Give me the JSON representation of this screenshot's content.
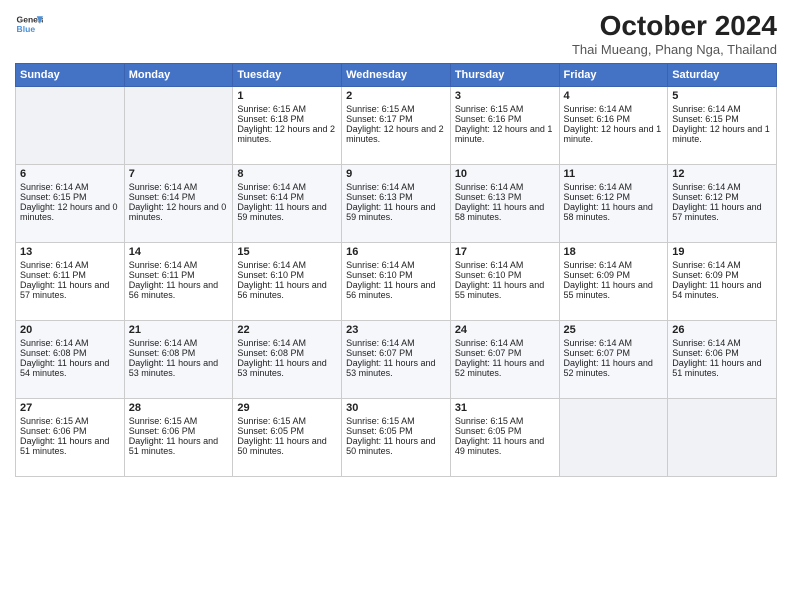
{
  "logo": {
    "line1": "General",
    "line2": "Blue"
  },
  "title": "October 2024",
  "subtitle": "Thai Mueang, Phang Nga, Thailand",
  "days_header": [
    "Sunday",
    "Monday",
    "Tuesday",
    "Wednesday",
    "Thursday",
    "Friday",
    "Saturday"
  ],
  "weeks": [
    [
      {
        "day": "",
        "empty": true
      },
      {
        "day": "",
        "empty": true
      },
      {
        "day": "1",
        "sunrise": "Sunrise: 6:15 AM",
        "sunset": "Sunset: 6:18 PM",
        "daylight": "Daylight: 12 hours and 2 minutes."
      },
      {
        "day": "2",
        "sunrise": "Sunrise: 6:15 AM",
        "sunset": "Sunset: 6:17 PM",
        "daylight": "Daylight: 12 hours and 2 minutes."
      },
      {
        "day": "3",
        "sunrise": "Sunrise: 6:15 AM",
        "sunset": "Sunset: 6:16 PM",
        "daylight": "Daylight: 12 hours and 1 minute."
      },
      {
        "day": "4",
        "sunrise": "Sunrise: 6:14 AM",
        "sunset": "Sunset: 6:16 PM",
        "daylight": "Daylight: 12 hours and 1 minute."
      },
      {
        "day": "5",
        "sunrise": "Sunrise: 6:14 AM",
        "sunset": "Sunset: 6:15 PM",
        "daylight": "Daylight: 12 hours and 1 minute."
      }
    ],
    [
      {
        "day": "6",
        "sunrise": "Sunrise: 6:14 AM",
        "sunset": "Sunset: 6:15 PM",
        "daylight": "Daylight: 12 hours and 0 minutes."
      },
      {
        "day": "7",
        "sunrise": "Sunrise: 6:14 AM",
        "sunset": "Sunset: 6:14 PM",
        "daylight": "Daylight: 12 hours and 0 minutes."
      },
      {
        "day": "8",
        "sunrise": "Sunrise: 6:14 AM",
        "sunset": "Sunset: 6:14 PM",
        "daylight": "Daylight: 11 hours and 59 minutes."
      },
      {
        "day": "9",
        "sunrise": "Sunrise: 6:14 AM",
        "sunset": "Sunset: 6:13 PM",
        "daylight": "Daylight: 11 hours and 59 minutes."
      },
      {
        "day": "10",
        "sunrise": "Sunrise: 6:14 AM",
        "sunset": "Sunset: 6:13 PM",
        "daylight": "Daylight: 11 hours and 58 minutes."
      },
      {
        "day": "11",
        "sunrise": "Sunrise: 6:14 AM",
        "sunset": "Sunset: 6:12 PM",
        "daylight": "Daylight: 11 hours and 58 minutes."
      },
      {
        "day": "12",
        "sunrise": "Sunrise: 6:14 AM",
        "sunset": "Sunset: 6:12 PM",
        "daylight": "Daylight: 11 hours and 57 minutes."
      }
    ],
    [
      {
        "day": "13",
        "sunrise": "Sunrise: 6:14 AM",
        "sunset": "Sunset: 6:11 PM",
        "daylight": "Daylight: 11 hours and 57 minutes."
      },
      {
        "day": "14",
        "sunrise": "Sunrise: 6:14 AM",
        "sunset": "Sunset: 6:11 PM",
        "daylight": "Daylight: 11 hours and 56 minutes."
      },
      {
        "day": "15",
        "sunrise": "Sunrise: 6:14 AM",
        "sunset": "Sunset: 6:10 PM",
        "daylight": "Daylight: 11 hours and 56 minutes."
      },
      {
        "day": "16",
        "sunrise": "Sunrise: 6:14 AM",
        "sunset": "Sunset: 6:10 PM",
        "daylight": "Daylight: 11 hours and 56 minutes."
      },
      {
        "day": "17",
        "sunrise": "Sunrise: 6:14 AM",
        "sunset": "Sunset: 6:10 PM",
        "daylight": "Daylight: 11 hours and 55 minutes."
      },
      {
        "day": "18",
        "sunrise": "Sunrise: 6:14 AM",
        "sunset": "Sunset: 6:09 PM",
        "daylight": "Daylight: 11 hours and 55 minutes."
      },
      {
        "day": "19",
        "sunrise": "Sunrise: 6:14 AM",
        "sunset": "Sunset: 6:09 PM",
        "daylight": "Daylight: 11 hours and 54 minutes."
      }
    ],
    [
      {
        "day": "20",
        "sunrise": "Sunrise: 6:14 AM",
        "sunset": "Sunset: 6:08 PM",
        "daylight": "Daylight: 11 hours and 54 minutes."
      },
      {
        "day": "21",
        "sunrise": "Sunrise: 6:14 AM",
        "sunset": "Sunset: 6:08 PM",
        "daylight": "Daylight: 11 hours and 53 minutes."
      },
      {
        "day": "22",
        "sunrise": "Sunrise: 6:14 AM",
        "sunset": "Sunset: 6:08 PM",
        "daylight": "Daylight: 11 hours and 53 minutes."
      },
      {
        "day": "23",
        "sunrise": "Sunrise: 6:14 AM",
        "sunset": "Sunset: 6:07 PM",
        "daylight": "Daylight: 11 hours and 53 minutes."
      },
      {
        "day": "24",
        "sunrise": "Sunrise: 6:14 AM",
        "sunset": "Sunset: 6:07 PM",
        "daylight": "Daylight: 11 hours and 52 minutes."
      },
      {
        "day": "25",
        "sunrise": "Sunrise: 6:14 AM",
        "sunset": "Sunset: 6:07 PM",
        "daylight": "Daylight: 11 hours and 52 minutes."
      },
      {
        "day": "26",
        "sunrise": "Sunrise: 6:14 AM",
        "sunset": "Sunset: 6:06 PM",
        "daylight": "Daylight: 11 hours and 51 minutes."
      }
    ],
    [
      {
        "day": "27",
        "sunrise": "Sunrise: 6:15 AM",
        "sunset": "Sunset: 6:06 PM",
        "daylight": "Daylight: 11 hours and 51 minutes."
      },
      {
        "day": "28",
        "sunrise": "Sunrise: 6:15 AM",
        "sunset": "Sunset: 6:06 PM",
        "daylight": "Daylight: 11 hours and 51 minutes."
      },
      {
        "day": "29",
        "sunrise": "Sunrise: 6:15 AM",
        "sunset": "Sunset: 6:05 PM",
        "daylight": "Daylight: 11 hours and 50 minutes."
      },
      {
        "day": "30",
        "sunrise": "Sunrise: 6:15 AM",
        "sunset": "Sunset: 6:05 PM",
        "daylight": "Daylight: 11 hours and 50 minutes."
      },
      {
        "day": "31",
        "sunrise": "Sunrise: 6:15 AM",
        "sunset": "Sunset: 6:05 PM",
        "daylight": "Daylight: 11 hours and 49 minutes."
      },
      {
        "day": "",
        "empty": true
      },
      {
        "day": "",
        "empty": true
      }
    ]
  ]
}
